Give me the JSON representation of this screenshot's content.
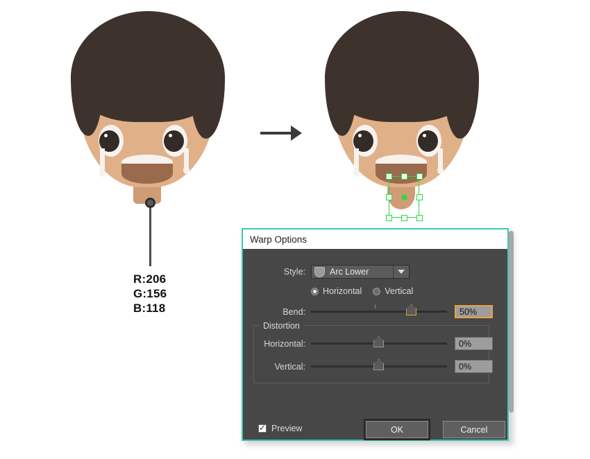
{
  "illustration": {
    "left_character": {
      "name": "crying-boy-face-original",
      "alt": "cartoon boy face with tears and straight neck"
    },
    "right_character": {
      "name": "crying-boy-face-warped",
      "alt": "cartoon boy face with warped neck selected"
    },
    "arrow": {
      "name": "transform-arrow"
    },
    "colors": {
      "skin": "#e0b089",
      "skin_neck": "#cf9c76",
      "hair": "#3e322d",
      "brow": "#3e322d",
      "eye_white": "#f6f2ee",
      "pupil": "#332b27",
      "mouth_top": "#f6f2ee",
      "mouth_bottom": "#9a6a4c",
      "selection_green": "#22dd44",
      "accent_orange": "#e8a33d",
      "dialog_border_teal": "#3ec8b0"
    },
    "callout": {
      "r_label": "R:206",
      "g_label": "G:156",
      "b_label": "B:118"
    }
  },
  "dialog": {
    "title": "Warp Options",
    "style": {
      "label": "Style:",
      "selected": "Arc Lower",
      "icon": "arc-lower-icon",
      "caret": "chevron-down-icon"
    },
    "orientation": {
      "horizontal_label": "Horizontal",
      "vertical_label": "Vertical",
      "selected": "Horizontal"
    },
    "bend": {
      "label": "Bend:",
      "value": "50%",
      "slider_percent": 72
    },
    "distortion": {
      "group_label": "Distortion",
      "horizontal": {
        "label": "Horizontal:",
        "value": "0%",
        "slider_percent": 50
      },
      "vertical": {
        "label": "Vertical:",
        "value": "0%",
        "slider_percent": 50
      }
    },
    "preview": {
      "label": "Preview",
      "checked": true
    },
    "buttons": {
      "ok": "OK",
      "cancel": "Cancel"
    }
  }
}
